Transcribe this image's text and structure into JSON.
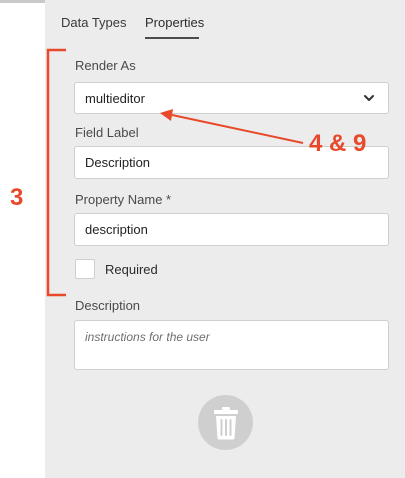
{
  "tabs": [
    {
      "label": "Data Types"
    },
    {
      "label": "Properties",
      "active": true
    }
  ],
  "form": {
    "render_as": {
      "label": "Render As",
      "value": "multieditor"
    },
    "field_label": {
      "label": "Field Label",
      "value": "Description"
    },
    "property_name": {
      "label": "Property Name *",
      "value": "description"
    },
    "required": {
      "label": "Required",
      "checked": false
    },
    "description": {
      "label": "Description",
      "placeholder": "instructions for the user"
    }
  },
  "annotations": {
    "bracket_label": "3",
    "arrow_label": "4 & 9",
    "color": "#e8492a"
  },
  "icons": {
    "dropdown": "chevron-down-icon",
    "delete": "trash-icon"
  }
}
